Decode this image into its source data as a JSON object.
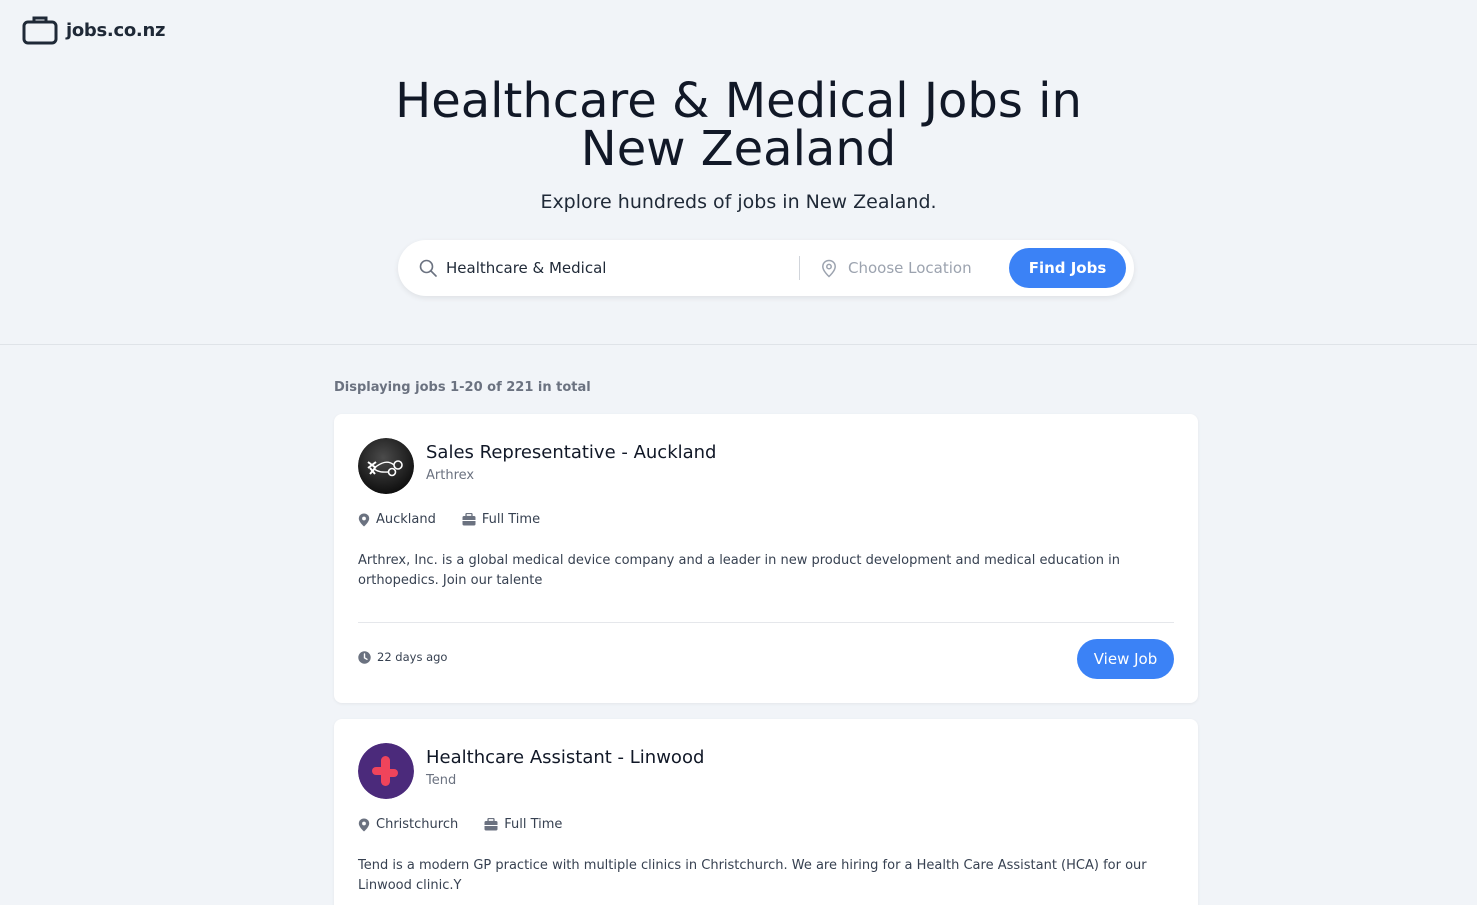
{
  "brand": {
    "name": "jobs.co.nz",
    "icon": "briefcase-icon"
  },
  "hero": {
    "title_line1": "Healthcare & Medical Jobs in",
    "title_line2": "New Zealand",
    "subtitle": "Explore hundreds of jobs in New Zealand."
  },
  "search": {
    "keyword_value": "Healthcare & Medical",
    "location_placeholder": "Choose Location",
    "button_label": "Find Jobs",
    "accent_color": "#3b82f6"
  },
  "results": {
    "summary": "Displaying jobs 1-20 of 221 in total"
  },
  "jobs": [
    {
      "title": "Sales Representative - Auckland",
      "company": "Arthrex",
      "location": "Auckland",
      "type": "Full Time",
      "description": "Arthrex, Inc. is a global medical device company and a leader in new product development and medical education in orthopedics. Join our talente",
      "posted": "22 days ago",
      "button_label": "View Job"
    },
    {
      "title": "Healthcare Assistant - Linwood",
      "company": "Tend",
      "location": "Christchurch",
      "type": "Full Time",
      "description": "Tend is a modern GP practice with multiple clinics in Christchurch. We are hiring for a Health Care Assistant (HCA) for our Linwood clinic.Y"
    }
  ]
}
